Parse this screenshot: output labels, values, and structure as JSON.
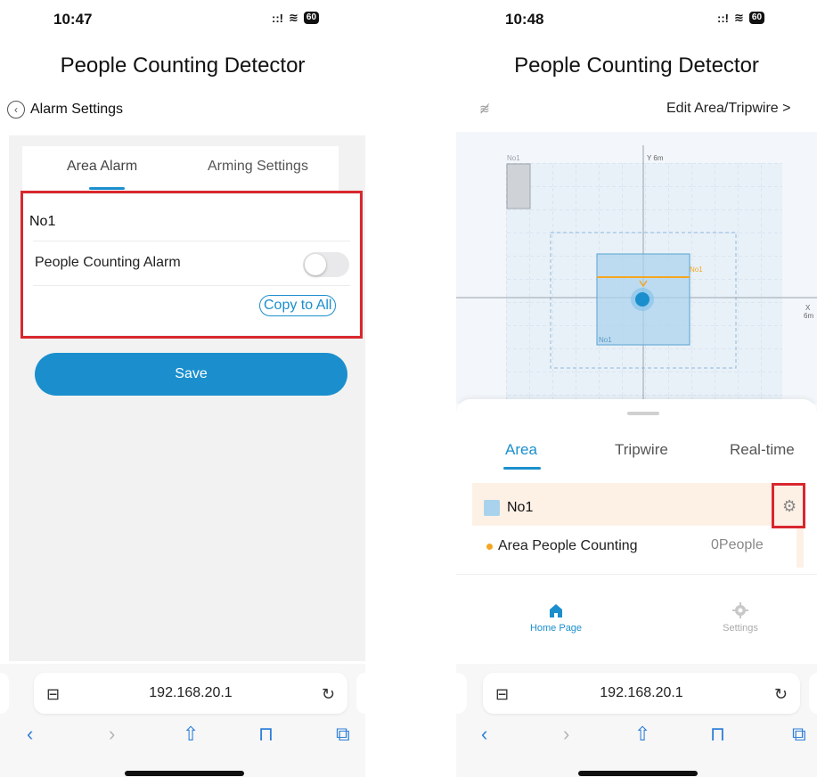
{
  "left": {
    "status": {
      "time": "10:47",
      "signal": "::!",
      "battery": "60"
    },
    "title": "People Counting Detector",
    "back_label": "Alarm Settings",
    "tabs": [
      "Area Alarm",
      "Arming Settings"
    ],
    "area_name": "No1",
    "alarm_label": "People Counting Alarm",
    "alarm_enabled": false,
    "copy_label": "Copy to All",
    "save_label": "Save",
    "browser": {
      "url": "192.168.20.1"
    }
  },
  "right": {
    "status": {
      "time": "10:48",
      "signal": "::!",
      "battery": "60"
    },
    "title": "People Counting Detector",
    "edit_label": "Edit Area/Tripwire >",
    "map": {
      "y_axis_label": "Y 6m",
      "x_axis_label_top": "X",
      "x_axis_label_bottom": "6m",
      "area_tag_top": "No1",
      "tripwire_tag": "No1",
      "area_tag_bottom": "No1"
    },
    "tabs": [
      "Area",
      "Tripwire",
      "Real-time"
    ],
    "area_name": "No1",
    "count_label": "Area People Counting",
    "count_value": "0People",
    "nav": {
      "home": "Home Page",
      "settings": "Settings"
    },
    "browser": {
      "url": "192.168.20.1"
    }
  },
  "colors": {
    "accent": "#1b8fcd",
    "highlight_border": "#d9272e",
    "area_row_bg": "#fdf1e6",
    "tripwire": "#f5a623"
  }
}
